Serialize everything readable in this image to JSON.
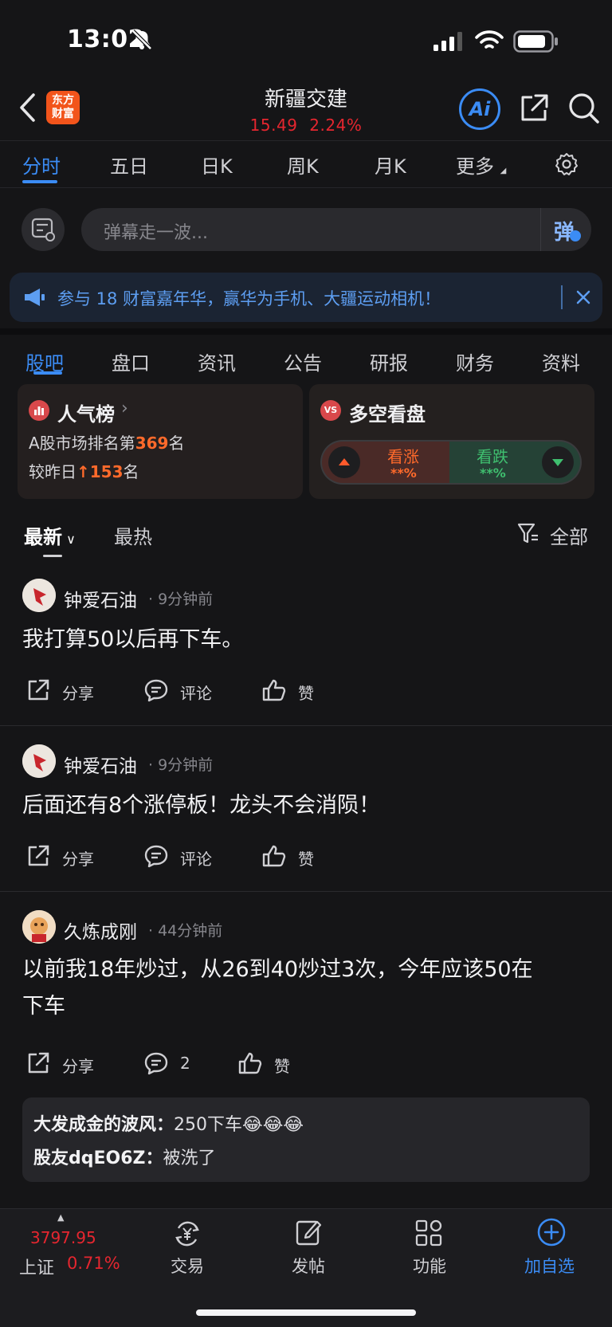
{
  "status_bar": {
    "time": "13:02"
  },
  "header": {
    "logo_line1": "东方",
    "logo_line2": "财富",
    "stock_name": "新疆交建",
    "price": "15.49",
    "change_pct": "2.24%",
    "ai_label": "Ai"
  },
  "period_tabs": [
    "分时",
    "五日",
    "日K",
    "周K",
    "月K",
    "更多"
  ],
  "danmaku": {
    "placeholder": "弹幕走一波...",
    "send_label": "弹"
  },
  "promo": {
    "text": "参与 18 财富嘉年华，赢华为手机、大疆运动相机！"
  },
  "section_tabs": [
    "股吧",
    "盘口",
    "资讯",
    "公告",
    "研报",
    "财务",
    "资料"
  ],
  "popularity": {
    "title": "人气榜",
    "rank_prefix": "A股市场排名第",
    "rank": "369",
    "rank_suffix": "名",
    "change_prefix": "较昨日",
    "change_value": "153",
    "change_suffix": "名"
  },
  "sentiment": {
    "title": "多空看盘",
    "vs_label": "VS",
    "up_label": "看涨",
    "up_pct": "**%",
    "down_label": "看跌",
    "down_pct": "**%"
  },
  "sort": {
    "latest": "最新",
    "hot": "最热",
    "filter": "全部"
  },
  "posts": [
    {
      "author": "钟爱石油",
      "time": "· 9分钟前",
      "content": "我打算50以后再下车。",
      "share": "分享",
      "comment": "评论",
      "like": "赞"
    },
    {
      "author": "钟爱石油",
      "time": "· 9分钟前",
      "content": "后面还有8个涨停板！龙头不会消陨！",
      "share": "分享",
      "comment": "评论",
      "like": "赞"
    },
    {
      "author": "久炼成刚",
      "time": "· 44分钟前",
      "content_line1": "以前我18年炒过，从26到40炒过3次，今年应该50在",
      "content_line2": "下车",
      "share": "分享",
      "comment": "2",
      "like": "赞",
      "replies": [
        {
          "user": "大发成金的波风：",
          "text": "250下车😂😂😂"
        },
        {
          "user": "股友dqEO6Z：",
          "text": "被洗了"
        }
      ]
    }
  ],
  "bottom_bar": {
    "index_value": "3797.95",
    "index_name": "上证",
    "index_change": "0.71%",
    "trade": "交易",
    "post": "发帖",
    "features": "功能",
    "add_watch": "加自选"
  },
  "colors": {
    "accent": "#3b8cf5",
    "up": "#e5262f",
    "highlight": "#ff6a2b",
    "down": "#3fbf6f"
  }
}
